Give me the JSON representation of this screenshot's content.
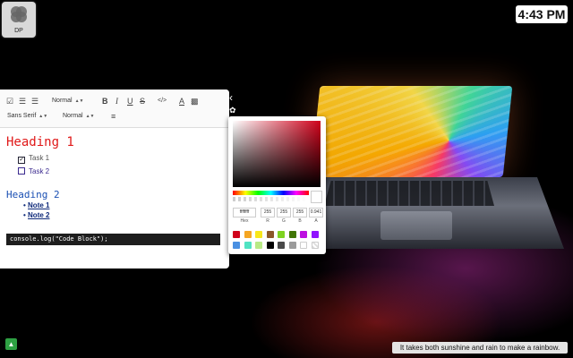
{
  "desktop": {
    "app_icon_label": "DP",
    "clock": "4:43 PM",
    "quote": "It takes both sunshine and rain to make a rainbow."
  },
  "editor": {
    "toolbar": {
      "heading_select": "Normal",
      "font_select": "Sans Serif",
      "size_select": "Normal",
      "bold_label": "B",
      "italic_label": "I",
      "underline_label": "U",
      "strike_label": "S",
      "code_label": "</>",
      "color_label": "A"
    },
    "content": {
      "heading1": "Heading 1",
      "task1": "Task 1",
      "task1_checked": true,
      "task2": "Task 2",
      "task2_checked": false,
      "heading2": "Heading 2",
      "note1": "Note 1",
      "note2": "Note 2",
      "code": "console.log(\"Code Block\");"
    }
  },
  "color_picker": {
    "hex": "ffffffff",
    "r": "255",
    "g": "255",
    "b": "255",
    "a": "0.941",
    "labels": {
      "hex": "Hex",
      "r": "R",
      "g": "G",
      "b": "B",
      "a": "A"
    },
    "base_hue": "#d0021b",
    "presets": [
      "#d0021b",
      "#f5a623",
      "#f8e71c",
      "#8b572a",
      "#7ed321",
      "#417505",
      "#bd10e0",
      "#9013fe",
      "#4a90e2",
      "#50e3c2",
      "#b8e986",
      "#000000",
      "#4a4a4a",
      "#9b9b9b",
      "#ffffff",
      "#ffffff00"
    ]
  },
  "colors": {
    "heading1": "#e01919",
    "heading2": "#1a4fb3",
    "status_button": "#2ea043"
  }
}
